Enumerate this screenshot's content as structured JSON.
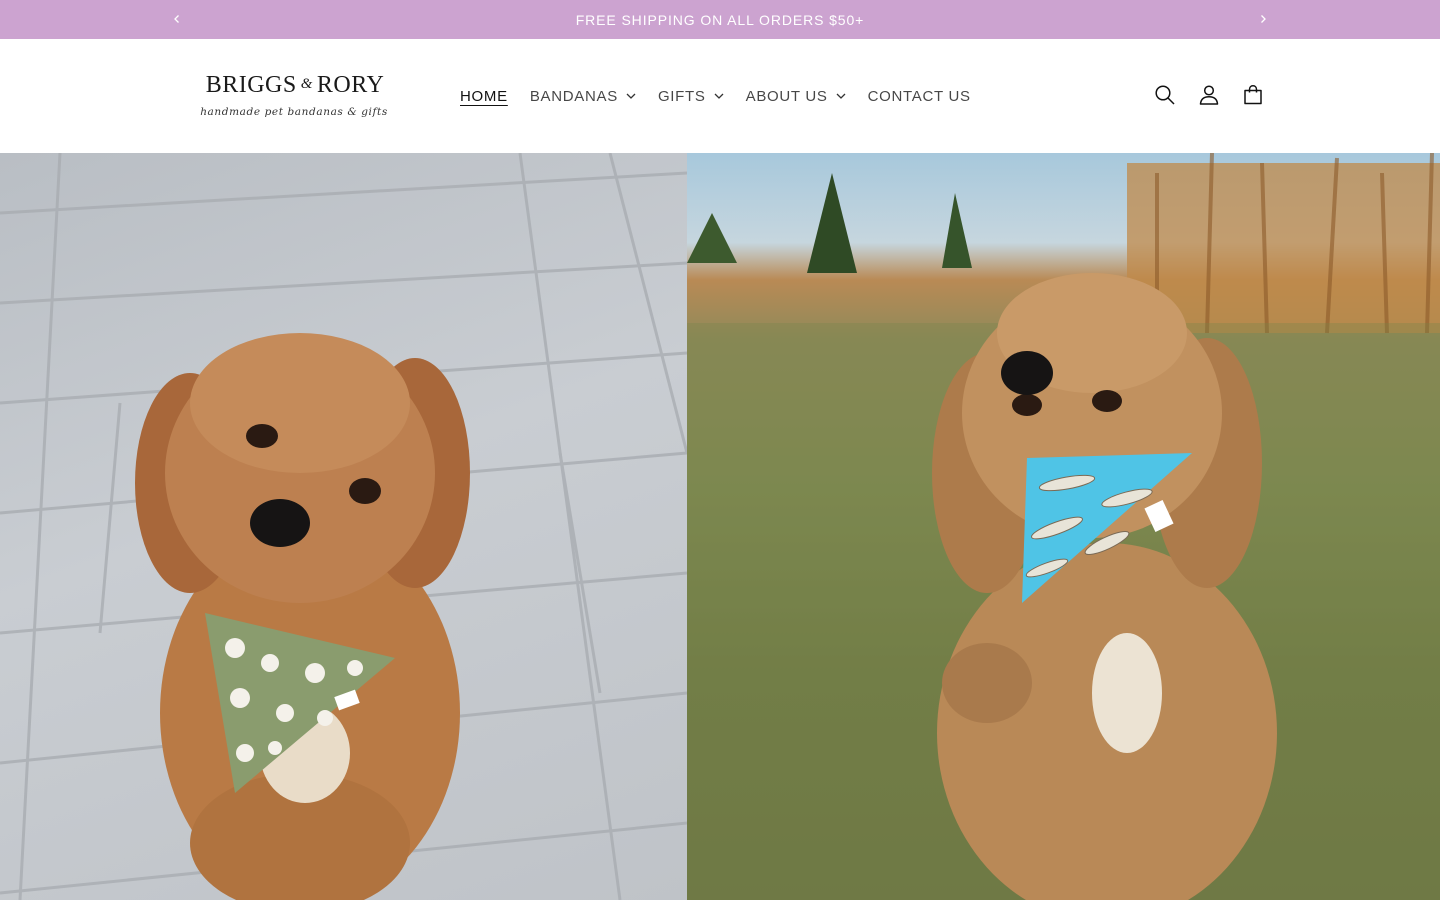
{
  "announcement": {
    "text": "FREE SHIPPING ON ALL ORDERS $50+",
    "background": "#cca3d0",
    "prev_icon": "chevron-left-icon",
    "next_icon": "chevron-right-icon"
  },
  "header": {
    "logo": {
      "name_left": "BRIGGS",
      "ampersand": "&",
      "name_right": "RORY",
      "tagline": "handmade pet bandanas & gifts"
    },
    "nav": [
      {
        "label": "HOME",
        "active": true,
        "has_dropdown": false
      },
      {
        "label": "BANDANAS",
        "active": false,
        "has_dropdown": true
      },
      {
        "label": "GIFTS",
        "active": false,
        "has_dropdown": true
      },
      {
        "label": "ABOUT US",
        "active": false,
        "has_dropdown": true
      },
      {
        "label": "CONTACT US",
        "active": false,
        "has_dropdown": false
      }
    ],
    "icons": [
      "search-icon",
      "account-icon",
      "cart-icon"
    ]
  },
  "hero": {
    "left_image": "dog-green-floral-bandana-on-pavers",
    "right_image": "dog-fish-print-bandana-on-grass",
    "colors": {
      "fur": "#b97a45",
      "green_bandana": "#8a9c6e",
      "blue_bandana": "#4fc4e6",
      "pavers": "#c4c8cc",
      "grass": "#75804a"
    }
  }
}
